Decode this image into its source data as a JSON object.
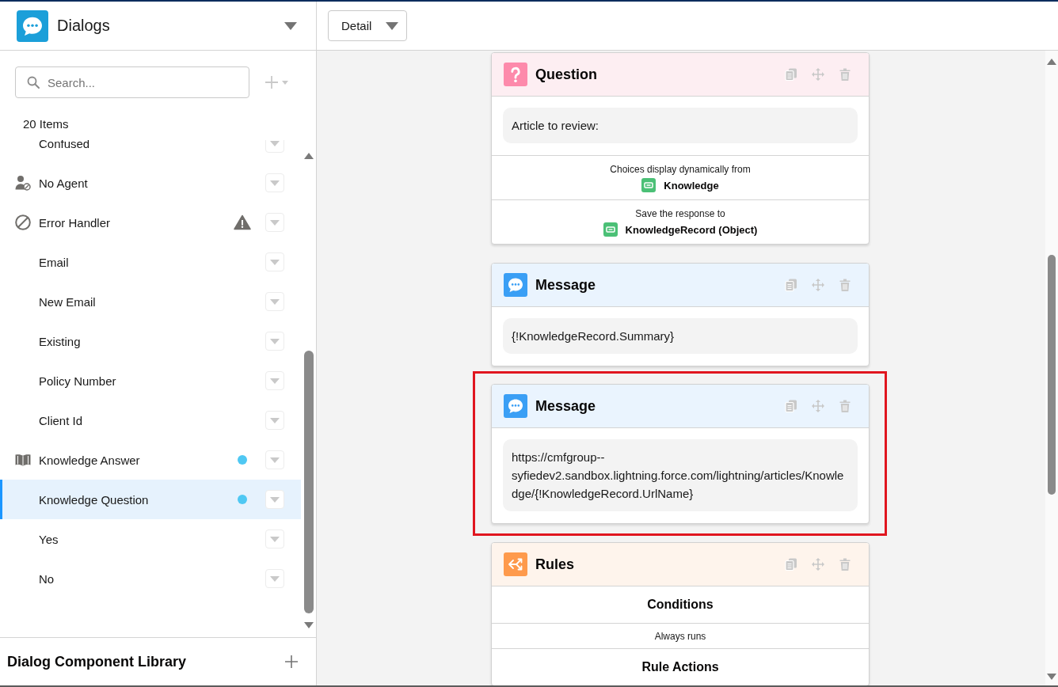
{
  "sidebar": {
    "title": "Dialogs",
    "search": {
      "placeholder": "Search..."
    },
    "count": "20 Items",
    "items": [
      {
        "label": "Confused",
        "kind": "plain",
        "selected": false,
        "warning": false,
        "modified": false
      },
      {
        "label": "No Agent",
        "kind": "agent",
        "selected": false,
        "warning": false,
        "modified": false
      },
      {
        "label": "Error Handler",
        "kind": "error",
        "selected": false,
        "warning": true,
        "modified": false
      },
      {
        "label": "Email",
        "kind": "plain",
        "selected": false,
        "warning": false,
        "modified": false
      },
      {
        "label": "New Email",
        "kind": "plain",
        "selected": false,
        "warning": false,
        "modified": false
      },
      {
        "label": "Existing",
        "kind": "plain",
        "selected": false,
        "warning": false,
        "modified": false
      },
      {
        "label": "Policy Number",
        "kind": "plain",
        "selected": false,
        "warning": false,
        "modified": false
      },
      {
        "label": "Client Id",
        "kind": "plain",
        "selected": false,
        "warning": false,
        "modified": false
      },
      {
        "label": "Knowledge Answer",
        "kind": "knowledge",
        "selected": false,
        "warning": false,
        "modified": true
      },
      {
        "label": "Knowledge Question",
        "kind": "plain",
        "selected": true,
        "warning": false,
        "modified": true
      },
      {
        "label": "Yes",
        "kind": "plain",
        "selected": false,
        "warning": false,
        "modified": false
      },
      {
        "label": "No",
        "kind": "plain",
        "selected": false,
        "warning": false,
        "modified": false
      }
    ],
    "footer_title": "Dialog Component Library"
  },
  "toolbar": {
    "view": "Detail"
  },
  "canvas": {
    "cards": [
      {
        "kind": "question",
        "title": "Question",
        "highlighted": false,
        "bubble": "Article to review:",
        "sections": [
          {
            "caption": "Choices display dynamically from",
            "value": "Knowledge"
          },
          {
            "caption": "Save the response to",
            "value": "KnowledgeRecord (Object)"
          }
        ]
      },
      {
        "kind": "message",
        "title": "Message",
        "highlighted": false,
        "bubble": "{!KnowledgeRecord.Summary}"
      },
      {
        "kind": "message",
        "title": "Message",
        "highlighted": true,
        "bubble": "https://cmfgroup--syfiedev2.sandbox.lightning.force.com/lightning/articles/Knowledge/{!KnowledgeRecord.UrlName}"
      },
      {
        "kind": "rules",
        "title": "Rules",
        "highlighted": false,
        "rows": [
          {
            "kind": "heading",
            "text": "Conditions"
          },
          {
            "kind": "note",
            "text": "Always runs"
          },
          {
            "kind": "heading",
            "text": "Rule Actions"
          }
        ]
      }
    ]
  }
}
